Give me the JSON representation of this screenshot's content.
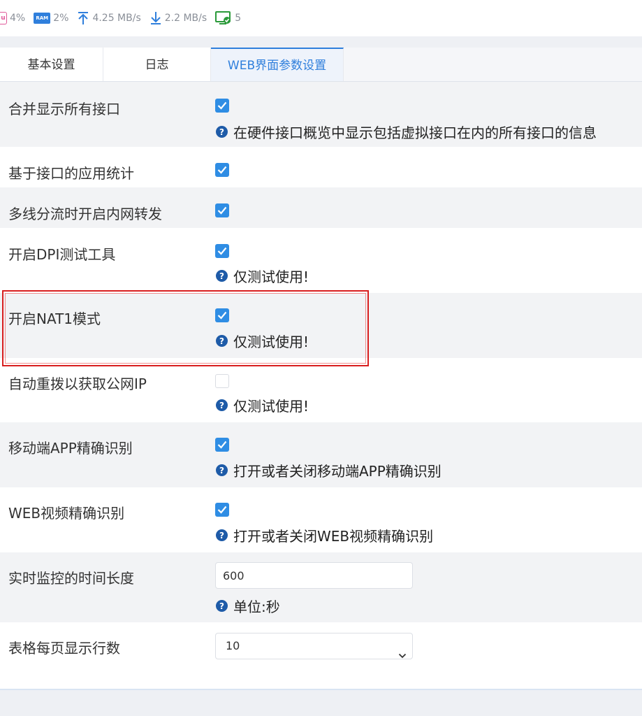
{
  "statusbar": {
    "cpu_value": "4%",
    "ram_label": "RAM",
    "ram_value": "2%",
    "upload_value": "4.25 MB/s",
    "download_value": "2.2 MB/s",
    "online_value": "5"
  },
  "tabs": [
    {
      "label": "基本设置",
      "active": false
    },
    {
      "label": "日志",
      "active": false
    },
    {
      "label": "WEB界面参数设置",
      "active": true
    }
  ],
  "settings": [
    {
      "label": "合并显示所有接口",
      "checked": true,
      "help": "在硬件接口概览中显示包括虚拟接口在内的所有接口的信息"
    },
    {
      "label": "基于接口的应用统计",
      "checked": true
    },
    {
      "label": "多线分流时开启内网转发",
      "checked": true
    },
    {
      "label": "开启DPI测试工具",
      "checked": true,
      "help": "仅测试使用!"
    },
    {
      "label": "开启NAT1模式",
      "checked": true,
      "help": "仅测试使用!"
    },
    {
      "label": "自动重拨以获取公网IP",
      "checked": false,
      "help": "仅测试使用!"
    },
    {
      "label": "移动端APP精确识别",
      "checked": true,
      "help": "打开或者关闭移动端APP精确识别"
    },
    {
      "label": "WEB视频精确识别",
      "checked": true,
      "help": "打开或者关闭WEB视频精确识别"
    },
    {
      "label": "实时监控的时间长度",
      "input_value": "600",
      "help": "单位:秒"
    },
    {
      "label": "表格每页显示行数",
      "select_value": "10"
    }
  ],
  "colors": {
    "accent": "#2f8de4",
    "help_icon": "#1e5ba8",
    "highlight": "#d81e1e"
  }
}
